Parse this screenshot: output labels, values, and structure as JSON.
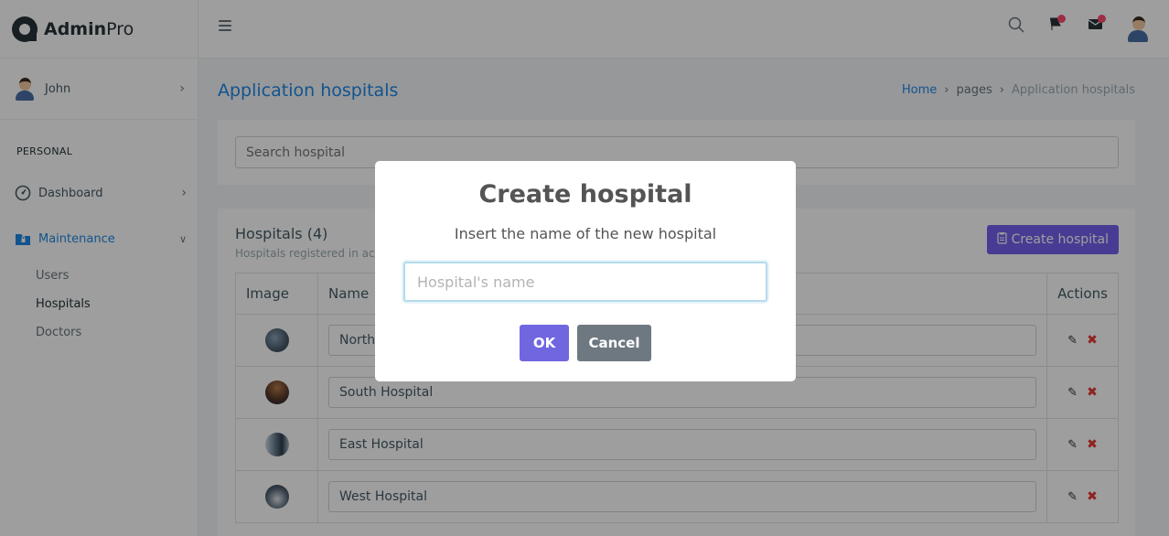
{
  "brand": {
    "name_bold": "Admin",
    "name_light": "Pro"
  },
  "sidebar": {
    "user_name": "John",
    "section_label": "PERSONAL",
    "items": [
      {
        "label": "Dashboard",
        "icon": "gauge-icon"
      },
      {
        "label": "Maintenance",
        "icon": "folder-lock-icon"
      }
    ],
    "sub_items": [
      {
        "label": "Users"
      },
      {
        "label": "Hospitals"
      },
      {
        "label": "Doctors"
      }
    ]
  },
  "topbar": {
    "icons": [
      "menu-icon",
      "search-icon",
      "flag-icon",
      "inbox-icon",
      "avatar"
    ]
  },
  "page": {
    "title": "Application hospitals",
    "breadcrumb": {
      "home": "Home",
      "mid": "pages",
      "current": "Application hospitals"
    }
  },
  "search": {
    "placeholder": "Search hospital"
  },
  "list": {
    "title": "Hospitals (4)",
    "subtitle": "Hospitals registered in ac",
    "create_label": "Create hospital",
    "columns": {
      "image": "Image",
      "name": "Name",
      "actions": "Actions"
    },
    "rows": [
      {
        "name": "North"
      },
      {
        "name": "South Hospital"
      },
      {
        "name": "East Hospital"
      },
      {
        "name": "West Hospital"
      }
    ]
  },
  "modal": {
    "title": "Create hospital",
    "text": "Insert the name of the new hospital",
    "input_placeholder": "Hospital's name",
    "ok_label": "OK",
    "cancel_label": "Cancel"
  },
  "colors": {
    "accent": "#1e88e5",
    "primary_button": "#7460ee",
    "ok_button": "#7066e0",
    "cancel_button": "#6e7881",
    "delete": "#e53935"
  }
}
